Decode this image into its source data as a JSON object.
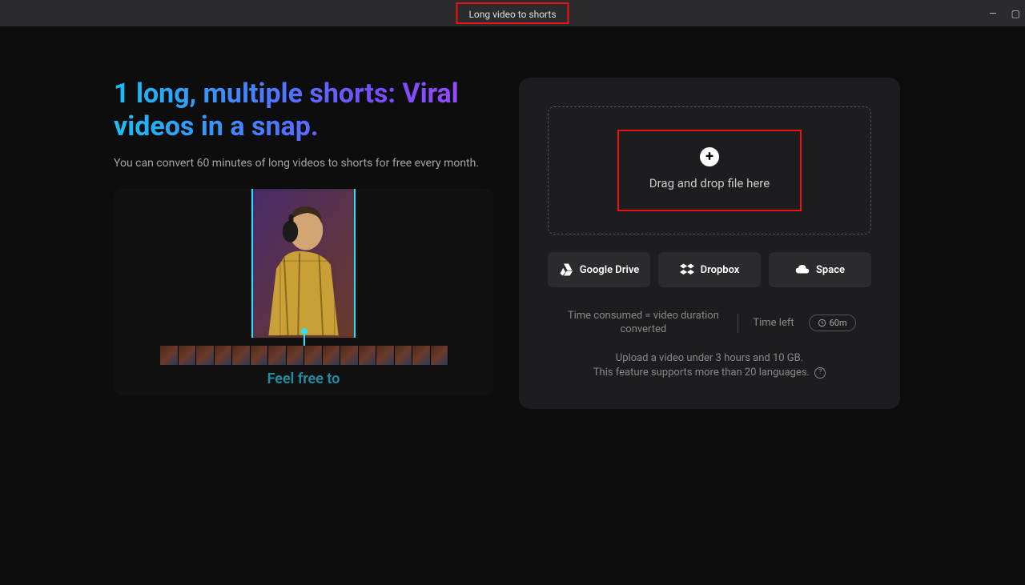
{
  "title": "Long video to shorts",
  "window": {
    "min": "—",
    "max": "▢"
  },
  "hero": {
    "headline": "1 long, multiple shorts: Viral videos in a snap.",
    "sub": "You can convert 60 minutes of long videos to shorts for free every month."
  },
  "preview": {
    "caption": "Feel free to"
  },
  "dropzone": {
    "text": "Drag and drop file here"
  },
  "cloud": {
    "gdrive": "Google Drive",
    "dropbox": "Dropbox",
    "space": "Space"
  },
  "info": {
    "time_consumed": "Time consumed = video duration converted",
    "time_left_label": "Time left",
    "time_left_value": "60m"
  },
  "limits": {
    "line1": "Upload a video under 3 hours and 10 GB.",
    "line2": "This feature supports more than 20 languages."
  }
}
